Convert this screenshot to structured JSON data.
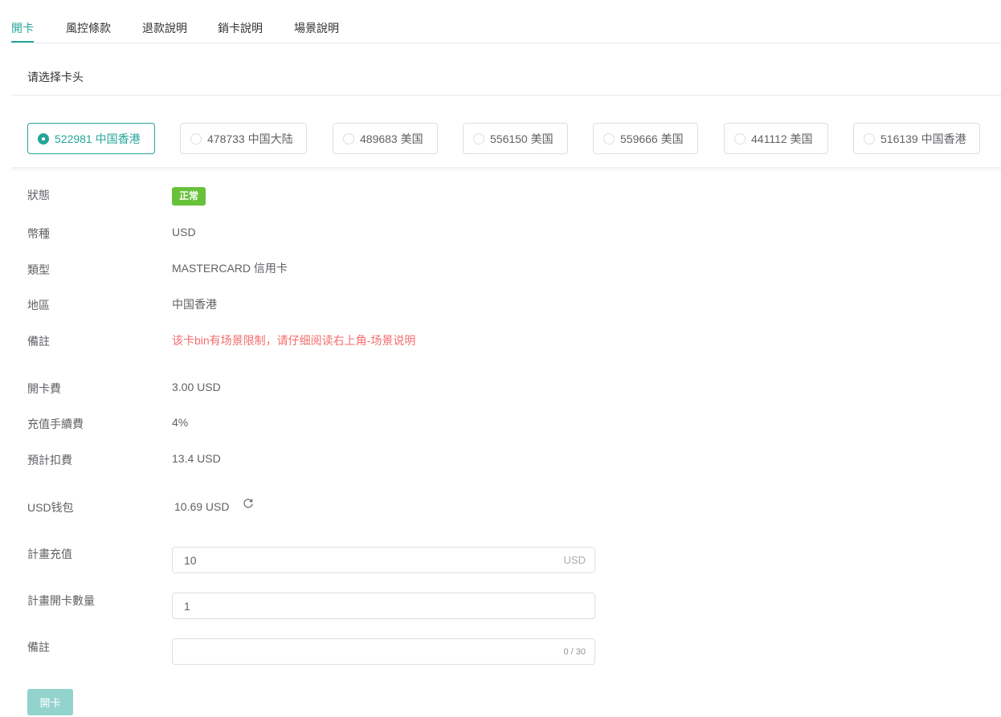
{
  "tabs": [
    {
      "label": "開卡",
      "active": true
    },
    {
      "label": "風控條款",
      "active": false
    },
    {
      "label": "退款說明",
      "active": false
    },
    {
      "label": "銷卡說明",
      "active": false
    },
    {
      "label": "場景說明",
      "active": false
    }
  ],
  "section_title": "请选择卡头",
  "bins": [
    {
      "label": "522981 中国香港",
      "selected": true
    },
    {
      "label": "478733 中国大陆",
      "selected": false
    },
    {
      "label": "489683 美国",
      "selected": false
    },
    {
      "label": "556150 美国",
      "selected": false
    },
    {
      "label": "559666 美国",
      "selected": false
    },
    {
      "label": "441112 美国",
      "selected": false
    },
    {
      "label": "516139 中国香港",
      "selected": false
    }
  ],
  "info": {
    "status_label": "狀態",
    "status_value": "正常",
    "currency_label": "幣種",
    "currency_value": "USD",
    "type_label": "類型",
    "type_value": "MASTERCARD 信用卡",
    "region_label": "地區",
    "region_value": "中国香港",
    "note_label": "備註",
    "note_value": "该卡bin有场景限制，请仔细阅读右上角-场景说明",
    "open_fee_label": "開卡費",
    "open_fee_value": "3.00 USD",
    "topup_fee_label": "充值手續費",
    "topup_fee_value": "4%",
    "estimated_label": "預計扣費",
    "estimated_value": "13.4 USD",
    "wallet_label": "USD钱包",
    "wallet_value": "10.69 USD"
  },
  "form": {
    "topup_label": "計畫充值",
    "topup_value": "10",
    "topup_suffix": "USD",
    "count_label": "計畫開卡數量",
    "count_value": "1",
    "remark_label": "備註",
    "remark_value": "",
    "remark_counter": "0 / 30",
    "submit_label": "開卡"
  },
  "colors": {
    "accent": "#26a69a",
    "status_green": "#67c23a",
    "warning_red": "#f56c6c",
    "button_disabled": "#93d3cd"
  },
  "icons": {
    "refresh": "refresh-icon"
  }
}
